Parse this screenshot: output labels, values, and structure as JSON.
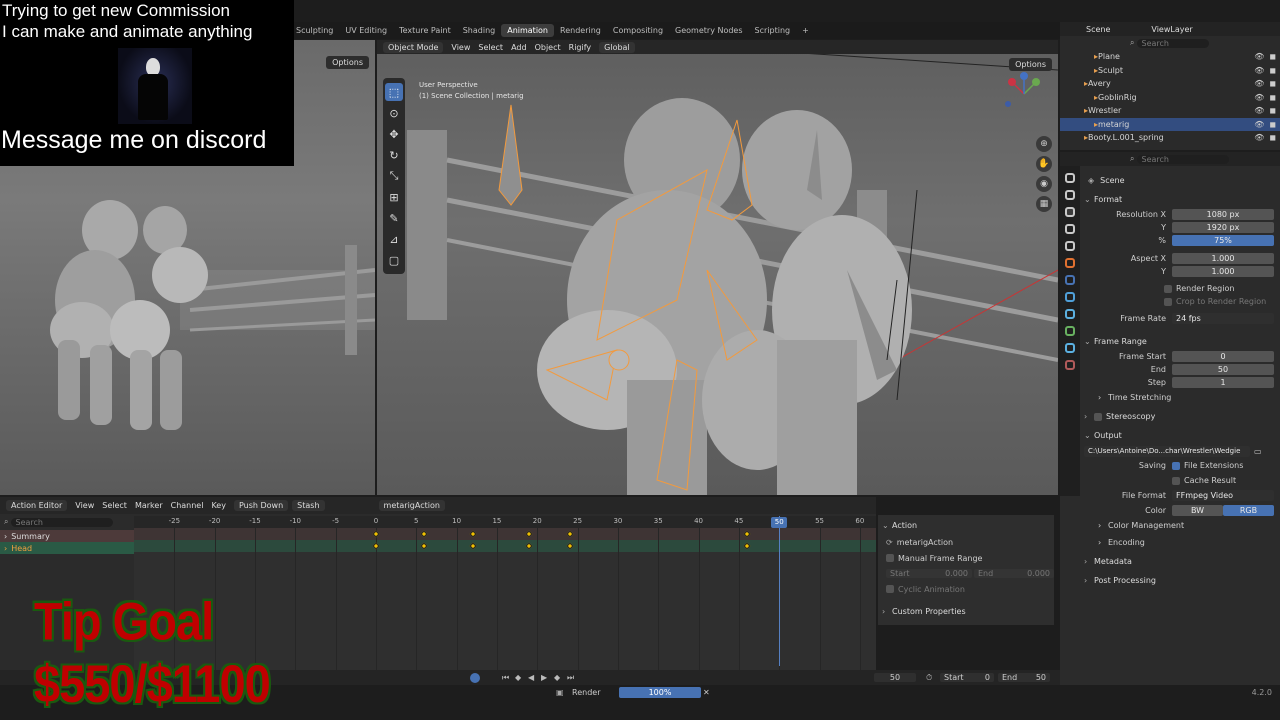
{
  "overlay": {
    "line1": "Trying to get new Commission",
    "line2": "I can make and animate anything",
    "line3": "Message me on discord",
    "tip_title": "Tip Goal",
    "tip_amount": "$550/$1100"
  },
  "workspace_tabs": [
    {
      "label": "Sculpting",
      "active": false
    },
    {
      "label": "UV Editing",
      "active": false
    },
    {
      "label": "Texture Paint",
      "active": false
    },
    {
      "label": "Shading",
      "active": false
    },
    {
      "label": "Animation",
      "active": true
    },
    {
      "label": "Rendering",
      "active": false
    },
    {
      "label": "Compositing",
      "active": false
    },
    {
      "label": "Geometry Nodes",
      "active": false
    },
    {
      "label": "Scripting",
      "active": false
    },
    {
      "label": "+",
      "active": false
    }
  ],
  "left_viewport": {
    "options_label": "Options"
  },
  "viewport": {
    "mode": "Object Mode",
    "menu": [
      "View",
      "Select",
      "Add",
      "Object",
      "Rigify"
    ],
    "orientation": "Global",
    "perspective": "User Perspective",
    "collection": "(1) Scene Collection | metarig",
    "options_label": "Options",
    "tools": [
      "select-box",
      "cursor",
      "move",
      "rotate",
      "scale",
      "transform",
      "annotate",
      "measure",
      "add-cube"
    ]
  },
  "outliner": {
    "scene": "Scene",
    "view_layer": "ViewLayer",
    "search_placeholder": "Search",
    "items": [
      {
        "label": "Plane",
        "indent": 2,
        "selected": false
      },
      {
        "label": "Sculpt",
        "indent": 2,
        "selected": false
      },
      {
        "label": "Avery",
        "indent": 1,
        "selected": false
      },
      {
        "label": "GoblinRig",
        "indent": 2,
        "selected": false
      },
      {
        "label": "Wrestler",
        "indent": 1,
        "selected": false
      },
      {
        "label": "metarig",
        "indent": 2,
        "selected": true
      },
      {
        "label": "Booty.L.001_spring",
        "indent": 1,
        "selected": false
      }
    ]
  },
  "properties": {
    "search_placeholder": "Search",
    "scene_label": "Scene",
    "format": {
      "title": "Format",
      "resolution_x_label": "Resolution X",
      "resolution_x": "1080 px",
      "resolution_y_label": "Y",
      "resolution_y": "1920 px",
      "percent_label": "%",
      "percent": "75%",
      "aspect_x_label": "Aspect X",
      "aspect_x": "1.000",
      "aspect_y_label": "Y",
      "aspect_y": "1.000",
      "render_region": "Render Region",
      "crop_region": "Crop to Render Region",
      "frame_rate_label": "Frame Rate",
      "frame_rate": "24 fps"
    },
    "frame_range": {
      "title": "Frame Range",
      "start_label": "Frame Start",
      "start": "0",
      "end_label": "End",
      "end": "50",
      "step_label": "Step",
      "step": "1",
      "time_stretching": "Time Stretching"
    },
    "stereoscopy": "Stereoscopy",
    "output": {
      "title": "Output",
      "path": "C:\\Users\\Antoine\\Do...char\\Wrestler\\Wedgie",
      "saving_label": "Saving",
      "file_extensions": "File Extensions",
      "cache_result": "Cache Result",
      "file_format_label": "File Format",
      "file_format": "FFmpeg Video",
      "color_label": "Color",
      "color_bw": "BW",
      "color_rgb": "RGB",
      "color_management": "Color Management",
      "encoding": "Encoding"
    },
    "metadata": "Metadata",
    "post_processing": "Post Processing"
  },
  "action_editor": {
    "editor": "Action Editor",
    "menu": [
      "View",
      "Select",
      "Marker",
      "Channel",
      "Key"
    ],
    "push_down": "Push Down",
    "stash": "Stash",
    "action_name": "metarigAction",
    "search_placeholder": "Search",
    "channels": [
      {
        "label": "Summary",
        "type": "summary"
      },
      {
        "label": "Head",
        "type": "group"
      }
    ],
    "ruler_ticks": [
      "-25",
      "-20",
      "-15",
      "-10",
      "-5",
      "0",
      "5",
      "10",
      "15",
      "20",
      "25",
      "30",
      "35",
      "40",
      "45",
      "50",
      "55",
      "60"
    ],
    "keyframes": [
      0,
      6,
      12,
      19,
      24,
      46
    ],
    "current_frame": "50"
  },
  "action_panel": {
    "title": "Action",
    "action_name": "metarigAction",
    "manual_frame_range": "Manual Frame Range",
    "start_label": "Start",
    "start": "0.000",
    "end_label": "End",
    "end": "0.000",
    "cyclic": "Cyclic Animation",
    "custom_properties": "Custom Properties"
  },
  "timeline": {
    "current": "50",
    "start_label": "Start",
    "start": "0",
    "end_label": "End",
    "end": "50"
  },
  "status": {
    "render_label": "Render",
    "progress": "100%",
    "progress_value": 100,
    "version": "4.2.0"
  }
}
